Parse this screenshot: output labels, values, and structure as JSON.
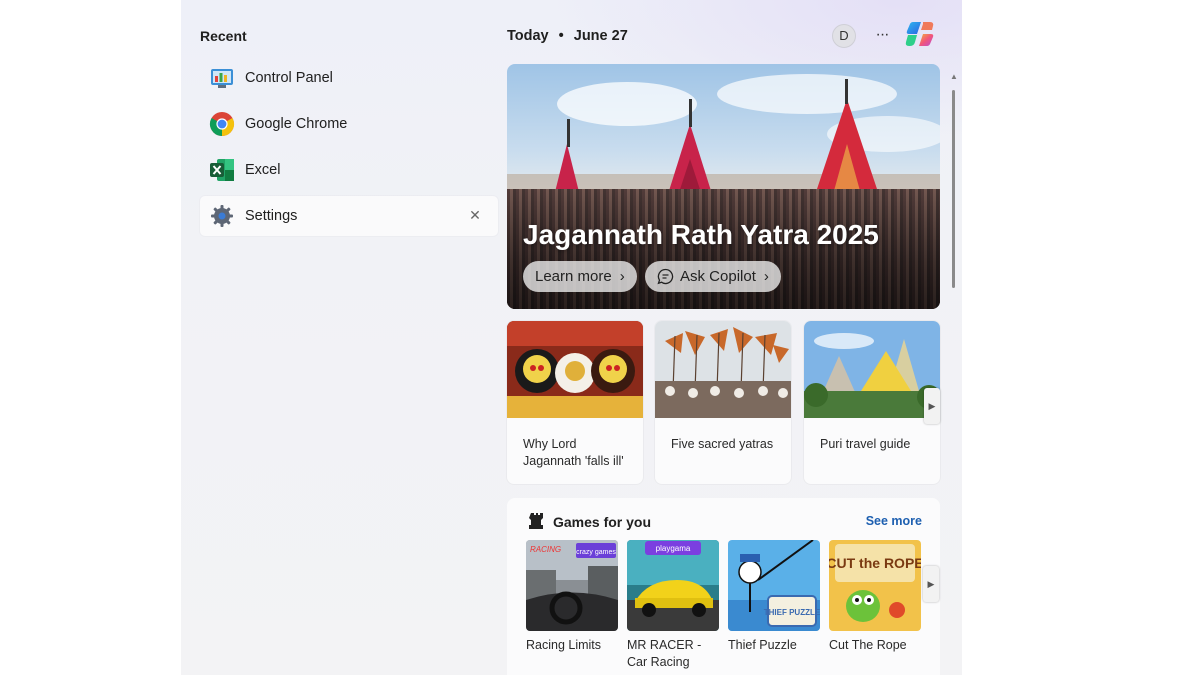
{
  "recent": {
    "title": "Recent",
    "items": [
      {
        "label": "Control Panel",
        "icon": "control-panel-icon"
      },
      {
        "label": "Google Chrome",
        "icon": "chrome-icon"
      },
      {
        "label": "Excel",
        "icon": "excel-icon"
      },
      {
        "label": "Settings",
        "icon": "gear-icon",
        "close": "✕"
      }
    ]
  },
  "header": {
    "today": "Today",
    "dot": "•",
    "date": "June 27",
    "avatar_letter": "D",
    "more": "···"
  },
  "hero": {
    "title": "Jagannath Rath Yatra 2025",
    "learn_more": "Learn more",
    "ask_copilot": "Ask Copilot",
    "chevron": "›"
  },
  "cards": [
    {
      "text": "Why Lord Jagannath 'falls ill'"
    },
    {
      "text": "Five sacred yatras"
    },
    {
      "text": "Puri travel guide"
    }
  ],
  "games": {
    "title": "Games for you",
    "see_more": "See more",
    "items": [
      {
        "name": "Racing Limits",
        "badge": "crazy games"
      },
      {
        "name": "MR RACER - Car Racing",
        "badge": "playgama"
      },
      {
        "name": "Thief Puzzle",
        "badge": "THIEF PUZZLE"
      },
      {
        "name": "Cut The Rope",
        "badge": "CUT the ROPE"
      }
    ]
  },
  "colors": {
    "accent_link": "#1d5fb0",
    "panel_bg": "#f1f2f6"
  }
}
